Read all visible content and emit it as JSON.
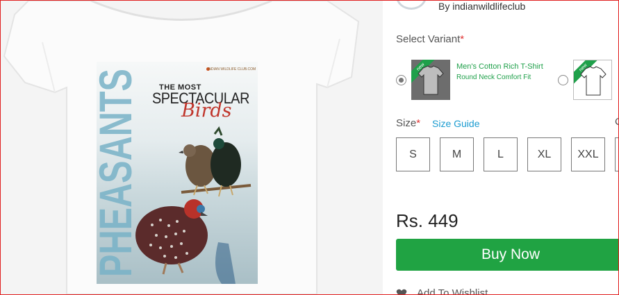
{
  "product": {
    "print_title_top": "THE MOST",
    "print_title_main": "SPECTACULAR",
    "print_title_script": "Birds",
    "print_vertical_word": "PHEASANTS",
    "print_club_line": "INDIAN WILDLIFE CLUB.COM"
  },
  "brand": {
    "by_line": "By indianwildlifeclub"
  },
  "variant": {
    "label": "Select Variant",
    "required_mark": "*",
    "options": [
      {
        "name": "Men's Cotton Rich T-Shirt",
        "sub": "Round Neck Comfort Fit",
        "badge": "new",
        "selected": true,
        "color": "dark"
      },
      {
        "name": "",
        "sub": "",
        "badge": "new",
        "selected": false,
        "color": "light"
      }
    ]
  },
  "size": {
    "label": "Size",
    "required_mark": "*",
    "guide_link": "Size Guide",
    "cut_text": "C",
    "options": [
      "S",
      "M",
      "L",
      "XL",
      "XXL"
    ]
  },
  "price": "Rs. 449",
  "buy_button": "Buy Now",
  "wishlist": "Add To Wishlist",
  "colors": {
    "accent_green": "#20a343",
    "link_blue": "#1a9bd0",
    "required_red": "#e03434",
    "frame_red": "#e02020"
  }
}
